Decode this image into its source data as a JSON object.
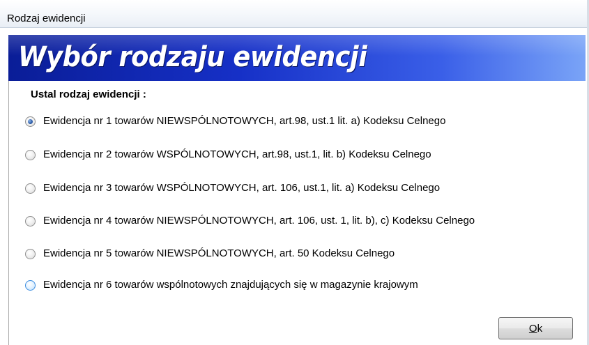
{
  "window": {
    "title": "Rodzaj ewidencji"
  },
  "banner": {
    "title": "Wybór rodzaju ewidencji"
  },
  "form": {
    "heading": "Ustal rodzaj ewidencji :",
    "options": [
      {
        "label": "Ewidencja nr 1 towarów NIEWSPÓLNOTOWYCH, art.98, ust.1 lit. a) Kodeksu Celnego",
        "checked": true
      },
      {
        "label": "Ewidencja nr 2 towarów WSPÓLNOTOWYCH, art.98, ust.1, lit. b) Kodeksu Celnego",
        "checked": false
      },
      {
        "label": "Ewidencja nr 3 towarów WSPÓLNOTOWYCH, art. 106, ust.1, lit. a) Kodeksu Celnego",
        "checked": false
      },
      {
        "label": "Ewidencja nr 4 towarów NIEWSPÓLNOTOWYCH, art. 106, ust. 1, lit. b), c) Kodeksu Celnego",
        "checked": false
      },
      {
        "label": "Ewidencja nr 5 towarów NIEWSPÓLNOTOWYCH, art. 50 Kodeksu Celnego",
        "checked": false
      },
      {
        "label": "Ewidencja nr 6 towarów wspólnotowych znajdujących się w magazynie krajowym",
        "checked": false,
        "hover": true
      }
    ]
  },
  "buttons": {
    "ok_mnemonic": "O",
    "ok_rest": "k"
  },
  "colors": {
    "banner_dark": "#0a1d97",
    "banner_light": "#7aa4f7",
    "radio_selected": "#2a5aa7",
    "radio_hover": "#3d8ee0"
  }
}
